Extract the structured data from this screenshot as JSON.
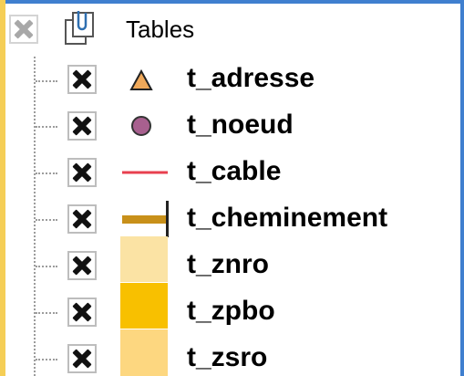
{
  "tree": {
    "group": {
      "label": "Tables",
      "visible": false
    },
    "layers": [
      {
        "name": "t_adresse",
        "symbol": "triangle-icon",
        "color": "#f0a95a"
      },
      {
        "name": "t_noeud",
        "symbol": "circle-icon",
        "color": "#a8608f"
      },
      {
        "name": "t_cable",
        "symbol": "line-icon",
        "color": "#e8404f"
      },
      {
        "name": "t_cheminement",
        "symbol": "thick-line-icon",
        "color": "#c8901a"
      },
      {
        "name": "t_znro",
        "symbol": "fill-icon",
        "color": "#fbe3a4"
      },
      {
        "name": "t_zpbo",
        "symbol": "fill-icon",
        "color": "#f8c000"
      },
      {
        "name": "t_zsro",
        "symbol": "fill-icon",
        "color": "#fdd780"
      }
    ]
  },
  "colors": {
    "accent_border": "#3f7fcf",
    "left_band": "#f5ce56"
  }
}
